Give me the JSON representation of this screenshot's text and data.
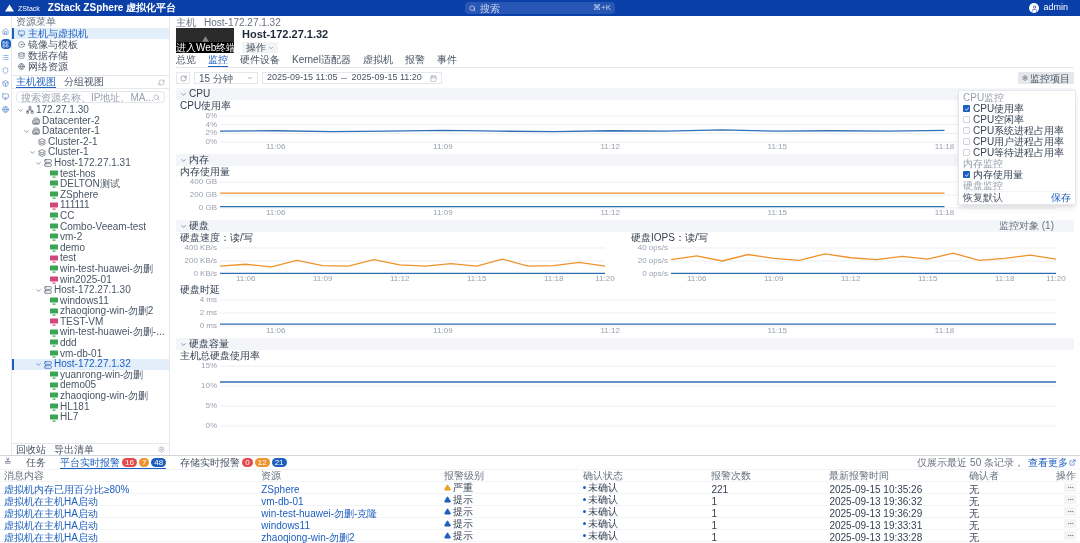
{
  "header": {
    "title": "ZStack ZSphere 虚拟化平台",
    "logo_text": "ZStack",
    "search_placeholder": "搜索",
    "shortcut": "⌘+K",
    "user": "admin"
  },
  "rail": [
    {
      "kind": "home",
      "selected": false
    },
    {
      "kind": "compute",
      "selected": true
    },
    {
      "kind": "list",
      "selected": false
    },
    {
      "kind": "shield",
      "selected": false
    },
    {
      "kind": "box",
      "selected": false
    },
    {
      "kind": "monitor",
      "selected": false
    },
    {
      "kind": "globe",
      "selected": false
    }
  ],
  "resource_menu": {
    "title": "资源菜单",
    "items": [
      {
        "label": "主机与虚拟机",
        "kind": "monitor",
        "selected": true
      },
      {
        "label": "镜像与模板",
        "kind": "disc",
        "selected": false
      },
      {
        "label": "数据存储",
        "kind": "database",
        "selected": false
      },
      {
        "label": "网络资源",
        "kind": "globe",
        "selected": false
      }
    ]
  },
  "tree_tabs": [
    {
      "label": "主机视图",
      "selected": true
    },
    {
      "label": "分组视图",
      "selected": false
    }
  ],
  "tree_search": {
    "placeholder": "搜索资源名称、IP地址、MA..."
  },
  "tree": [
    {
      "label": "172.27.1.30",
      "kind": "zone",
      "expanded": true,
      "selected": false,
      "children": [
        {
          "label": "Datacenter-2",
          "kind": "datacenter",
          "selected": false
        },
        {
          "label": "Datacenter-1",
          "kind": "datacenter",
          "expanded": true,
          "selected": false,
          "children": [
            {
              "label": "Cluster-2-1",
              "kind": "cluster",
              "selected": false
            },
            {
              "label": "Cluster-1",
              "kind": "cluster",
              "expanded": true,
              "selected": false,
              "children": [
                {
                  "label": "Host-172.27.1.31",
                  "kind": "host",
                  "expanded": true,
                  "selected": false,
                  "children": [
                    {
                      "label": "test-hos",
                      "kind": "vm",
                      "color": "#3aa655",
                      "selected": false
                    },
                    {
                      "label": "DELTON测试",
                      "kind": "vm",
                      "color": "#3aa655",
                      "selected": false
                    },
                    {
                      "label": "ZSphere",
                      "kind": "vm",
                      "color": "#3aa655",
                      "selected": false
                    },
                    {
                      "label": "111111",
                      "kind": "vm",
                      "color": "#d0487a",
                      "selected": false
                    },
                    {
                      "label": "CC",
                      "kind": "vm",
                      "color": "#3aa655",
                      "selected": false
                    },
                    {
                      "label": "Combo-Veeam-test",
                      "kind": "vm",
                      "color": "#3aa655",
                      "selected": false
                    },
                    {
                      "label": "vm-2",
                      "kind": "vm",
                      "color": "#3aa655",
                      "selected": false
                    },
                    {
                      "label": "demo",
                      "kind": "vm",
                      "color": "#3aa655",
                      "selected": false
                    },
                    {
                      "label": "test",
                      "kind": "vm",
                      "color": "#d0487a",
                      "selected": false
                    },
                    {
                      "label": "win-test-huawei-勿删",
                      "kind": "vm",
                      "color": "#3aa655",
                      "selected": false
                    },
                    {
                      "label": "win2025-01",
                      "kind": "vm",
                      "color": "#d0487a",
                      "selected": false
                    }
                  ]
                },
                {
                  "label": "Host-172.27.1.30",
                  "kind": "host",
                  "expanded": true,
                  "selected": false,
                  "children": [
                    {
                      "label": "windows11",
                      "kind": "vm",
                      "color": "#3aa655",
                      "selected": false
                    },
                    {
                      "label": "zhaoqiong-win-勿删2",
                      "kind": "vm",
                      "color": "#3aa655",
                      "selected": false
                    },
                    {
                      "label": "TEST-VM",
                      "kind": "vm",
                      "color": "#d0487a",
                      "selected": false
                    },
                    {
                      "label": "win-test-huawei-勿删-...",
                      "kind": "vm",
                      "color": "#3aa655",
                      "selected": false
                    },
                    {
                      "label": "ddd",
                      "kind": "vm",
                      "color": "#3aa655",
                      "selected": false
                    },
                    {
                      "label": "vm-db-01",
                      "kind": "vm",
                      "color": "#3aa655",
                      "selected": false
                    }
                  ]
                },
                {
                  "label": "Host-172.27.1.32",
                  "kind": "host",
                  "expanded": true,
                  "selected": true,
                  "children": [
                    {
                      "label": "yuanrong-win-勿删",
                      "kind": "vm",
                      "color": "#3aa655",
                      "selected": false
                    },
                    {
                      "label": "demo05",
                      "kind": "vm",
                      "color": "#3aa655",
                      "selected": false
                    },
                    {
                      "label": "zhaoqiong-win-勿删",
                      "kind": "vm",
                      "color": "#3aa655",
                      "selected": false
                    },
                    {
                      "label": "HL181",
                      "kind": "vm",
                      "color": "#3aa655",
                      "selected": false
                    },
                    {
                      "label": "HL7",
                      "kind": "vm",
                      "color": "#3aa655",
                      "selected": false
                    }
                  ]
                }
              ]
            }
          ]
        }
      ]
    }
  ],
  "sidebar_footer": [
    "回收站",
    "导出清单"
  ],
  "breadcrumb": [
    "主机",
    "Host-172.27.1.32"
  ],
  "host": {
    "console_label": "进入Web终端",
    "title": "Host-172.27.1.32",
    "action": "操作"
  },
  "tabs": [
    {
      "label": "总览",
      "selected": false
    },
    {
      "label": "监控",
      "selected": true
    },
    {
      "label": "硬件设备",
      "selected": false
    },
    {
      "label": "Kernel适配器",
      "selected": false
    },
    {
      "label": "虚拟机",
      "selected": false
    },
    {
      "label": "报警",
      "selected": false
    },
    {
      "label": "事件",
      "selected": false
    }
  ],
  "toolbar": {
    "range": "15 分钟",
    "start": "2025-09-15 11:05",
    "end": "2025-09-15 11:20",
    "monitor_button": "监控项目"
  },
  "sections": [
    {
      "title": "CPU",
      "charts": [
        {
          "title": "CPU使用率",
          "chart_data": {
            "type": "line",
            "ylim": [
              0,
              6
            ],
            "yticks": [
              {
                "value": 6,
                "label": "6%"
              },
              {
                "value": 4,
                "label": "4%"
              },
              {
                "value": 2,
                "label": "2%"
              },
              {
                "value": 0,
                "label": "0%"
              }
            ],
            "categories": [
              null,
              "11:06",
              null,
              null,
              "11:09",
              null,
              null,
              "11:12",
              null,
              null,
              "11:15",
              null,
              null,
              "11:18",
              null,
              null
            ],
            "series": [
              {
                "color": "#2f6fb3",
                "values": [
                  2.5,
                  2.6,
                  2.4,
                  2.5,
                  2.7,
                  2.5,
                  2.4,
                  2.6,
                  2.5,
                  2.8,
                  2.5,
                  2.6,
                  2.5,
                  2.7,
                  null,
                  null
                ]
              }
            ]
          }
        }
      ]
    },
    {
      "title": "内存",
      "charts": [
        {
          "title": "内存使用量",
          "chart_data": {
            "type": "line",
            "ylim": [
              0,
              400
            ],
            "yticks": [
              {
                "value": 400,
                "label": "400 GB"
              },
              {
                "value": 200,
                "label": "200 GB"
              },
              {
                "value": 0,
                "label": "0 GB"
              }
            ],
            "categories": [
              null,
              "11:06",
              null,
              null,
              "11:09",
              null,
              null,
              "11:12",
              null,
              null,
              "11:15",
              null,
              null,
              "11:18",
              null,
              null
            ],
            "series": [
              {
                "color": "#f0922b",
                "values": [
                  230,
                  230,
                  230,
                  230,
                  230,
                  230,
                  230,
                  230,
                  230,
                  230,
                  230,
                  230,
                  230,
                  230,
                  null,
                  null
                ]
              },
              {
                "color": "#2f6fb3",
                "values": [
                  20,
                  20,
                  20,
                  20,
                  20,
                  20,
                  20,
                  20,
                  20,
                  20,
                  20,
                  20,
                  20,
                  20,
                  null,
                  null
                ]
              }
            ]
          }
        }
      ]
    },
    {
      "title": "硬盘",
      "extra": "监控对象 (1)",
      "charts": [
        {
          "title": "硬盘速度：读/写",
          "half": true,
          "chart_data": {
            "type": "line",
            "ylim": [
              0,
              400
            ],
            "yticks": [
              {
                "value": 400,
                "label": "400 KB/s"
              },
              {
                "value": 200,
                "label": "200 KB/s"
              },
              {
                "value": 0,
                "label": "0 KB/s"
              }
            ],
            "categories": [
              null,
              "11:06",
              null,
              null,
              "11:09",
              null,
              null,
              "11:12",
              null,
              null,
              "11:15",
              null,
              null,
              "11:18",
              null,
              "11:20"
            ],
            "series": [
              {
                "color": "#f0922b",
                "values": [
                  120,
                  150,
                  110,
                  210,
                  130,
                  120,
                  220,
                  140,
                  120,
                  160,
                  120,
                  230,
                  120,
                  130,
                  180,
                  120
                ]
              },
              {
                "color": "#2f6fb3",
                "values": [
                  10,
                  10,
                  10,
                  10,
                  10,
                  10,
                  10,
                  10,
                  10,
                  10,
                  10,
                  10,
                  10,
                  10,
                  10,
                  10
                ]
              }
            ]
          }
        },
        {
          "title": "硬盘IOPS：读/写",
          "half": true,
          "chart_data": {
            "type": "line",
            "ylim": [
              0,
              40
            ],
            "yticks": [
              {
                "value": 40,
                "label": "40 ops/s"
              },
              {
                "value": 20,
                "label": "20 ops/s"
              },
              {
                "value": 0,
                "label": "0 ops/s"
              }
            ],
            "categories": [
              null,
              "11:06",
              null,
              null,
              "11:09",
              null,
              null,
              "11:12",
              null,
              null,
              "11:15",
              null,
              null,
              "11:18",
              null,
              "11:20"
            ],
            "series": [
              {
                "color": "#f0922b",
                "values": [
                  22,
                  28,
                  20,
                  30,
                  24,
                  21,
                  31,
                  25,
                  22,
                  27,
                  23,
                  32,
                  21,
                  24,
                  29,
                  23
                ]
              },
              {
                "color": "#2f6fb3",
                "values": [
                  1,
                  1,
                  1,
                  1,
                  1,
                  1,
                  1,
                  1,
                  1,
                  1,
                  1,
                  1,
                  1,
                  1,
                  1,
                  1
                ]
              }
            ]
          }
        },
        {
          "title": "硬盘时延",
          "chart_data": {
            "type": "line",
            "ylim": [
              0,
              4
            ],
            "yticks": [
              {
                "value": 4,
                "label": "4 ms"
              },
              {
                "value": 2,
                "label": "2 ms"
              },
              {
                "value": 0,
                "label": "0 ms"
              }
            ],
            "categories": [
              null,
              "11:06",
              null,
              null,
              "11:09",
              null,
              null,
              "11:12",
              null,
              null,
              "11:15",
              null,
              null,
              "11:18",
              null,
              null
            ],
            "series": [
              {
                "color": "#2f6fb3",
                "values": [
                  0.3,
                  0.3,
                  0.3,
                  0.3,
                  0.3,
                  0.3,
                  0.3,
                  0.3,
                  0.3,
                  0.3,
                  0.3,
                  0.3,
                  0.3,
                  0.3,
                  0.3,
                  0.3
                ]
              }
            ]
          }
        }
      ]
    },
    {
      "title": "硬盘容量",
      "charts": [
        {
          "title": "主机总硬盘使用率",
          "chart_data": {
            "type": "line",
            "ylim": [
              0,
              15
            ],
            "yticks": [
              {
                "value": 15,
                "label": "15%"
              },
              {
                "value": 10,
                "label": "10%"
              },
              {
                "value": 5,
                "label": "5%"
              },
              {
                "value": 0,
                "label": "0%"
              }
            ],
            "series": [
              {
                "color": "#2f6fb3",
                "values": [
                  11,
                  11,
                  11,
                  11,
                  11,
                  11,
                  11,
                  11,
                  11,
                  11,
                  11,
                  11,
                  11,
                  11,
                  11,
                  11
                ]
              }
            ]
          }
        }
      ]
    }
  ],
  "monitor_menu": {
    "groups": [
      {
        "title": "CPU监控",
        "items": [
          {
            "label": "CPU使用率",
            "checked": true
          },
          {
            "label": "CPU空闲率",
            "checked": false
          },
          {
            "label": "CPU系统进程占用率",
            "checked": false
          },
          {
            "label": "CPU用户进程占用率",
            "checked": false
          },
          {
            "label": "CPU等待进程占用率",
            "checked": false
          }
        ]
      },
      {
        "title": "内存监控",
        "items": [
          {
            "label": "内存使用量",
            "checked": true
          }
        ]
      },
      {
        "title": "硬盘监控"
      }
    ],
    "reset": "恢复默认",
    "save": "保存"
  },
  "alerts": {
    "collapse": "≚",
    "tabs": [
      {
        "label": "任务",
        "selected": false
      },
      {
        "label": "平台实时报警",
        "selected": true,
        "badges": [
          {
            "text": "16",
            "color": "#e5484d"
          },
          {
            "text": "7",
            "color": "#f0922b"
          },
          {
            "text": "48",
            "color": "#1d5fbf"
          }
        ]
      },
      {
        "label": "存储实时报警",
        "selected": false,
        "badges": [
          {
            "text": "0",
            "color": "#e5484d"
          },
          {
            "text": "12",
            "color": "#f0922b"
          },
          {
            "text": "21",
            "color": "#1d5fbf"
          }
        ]
      }
    ],
    "note": "仅展示最近 50 条记录，",
    "more": "查看更多",
    "columns": [
      "消息内容",
      "资源",
      "报警级别",
      "确认状态",
      "报警次数",
      "最新报警时间",
      "确认者",
      "操作"
    ],
    "rows": [
      {
        "message": "虚拟机内存已用百分比≥80%",
        "resource": "ZSphere",
        "level": {
          "kind": "critical",
          "text": "严重"
        },
        "status": "未确认",
        "count": "221",
        "time": "2025-09-15 10:35:26",
        "confirmer": "无"
      },
      {
        "message": "虚拟机在主机HA启动",
        "resource": "vm-db-01",
        "level": {
          "kind": "info",
          "text": "提示"
        },
        "status": "未确认",
        "count": "1",
        "time": "2025-09-13 19:36:32",
        "confirmer": "无"
      },
      {
        "message": "虚拟机在主机HA启动",
        "resource": "win-test-huawei-勿删-克隆",
        "level": {
          "kind": "info",
          "text": "提示"
        },
        "status": "未确认",
        "count": "1",
        "time": "2025-09-13 19:36:29",
        "confirmer": "无"
      },
      {
        "message": "虚拟机在主机HA启动",
        "resource": "windows11",
        "level": {
          "kind": "info",
          "text": "提示"
        },
        "status": "未确认",
        "count": "1",
        "time": "2025-09-13 19:33:31",
        "confirmer": "无"
      },
      {
        "message": "虚拟机在主机HA启动",
        "resource": "zhaoqiong-win-勿删2",
        "level": {
          "kind": "info",
          "text": "提示"
        },
        "status": "未确认",
        "count": "1",
        "time": "2025-09-13 19:33:28",
        "confirmer": "无"
      }
    ]
  }
}
